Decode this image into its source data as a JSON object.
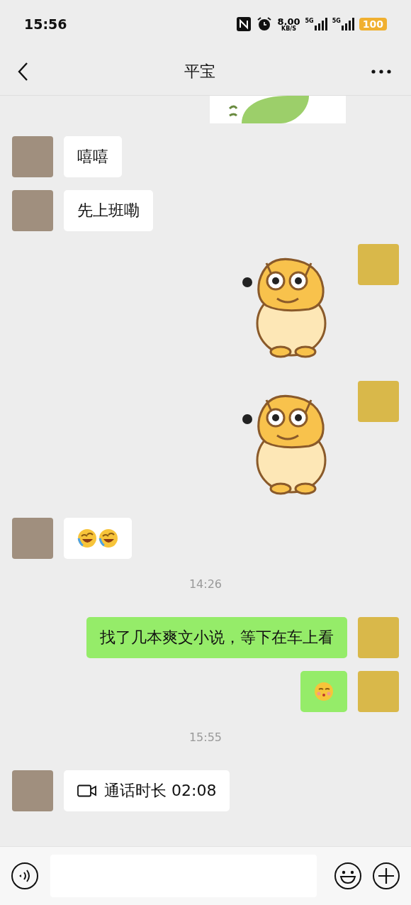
{
  "status_bar": {
    "time": "15:56",
    "speed": "8.00",
    "speed_unit": "KB/S",
    "networks": [
      "5G",
      "5G"
    ],
    "battery": "100"
  },
  "header": {
    "title": "平宝"
  },
  "messages": [
    {
      "kind": "sticker-partial"
    },
    {
      "kind": "text",
      "outgoing": false,
      "text": "嘻嘻"
    },
    {
      "kind": "text",
      "outgoing": false,
      "text": "先上班嘞"
    },
    {
      "kind": "sticker",
      "outgoing": true
    },
    {
      "kind": "sticker",
      "outgoing": true
    },
    {
      "kind": "emoji",
      "outgoing": false,
      "faces": [
        {
          "kind": "laughing"
        },
        {
          "kind": "laughing"
        }
      ]
    },
    {
      "kind": "time",
      "text": "14:26"
    },
    {
      "kind": "text",
      "outgoing": true,
      "text": "找了几本爽文小说，等下在车上看"
    },
    {
      "kind": "emoji",
      "outgoing": true,
      "faces": [
        {
          "kind": "kissing"
        }
      ]
    },
    {
      "kind": "time",
      "text": "15:55"
    },
    {
      "kind": "call",
      "outgoing": false,
      "text": "通话时长 02:08"
    }
  ]
}
